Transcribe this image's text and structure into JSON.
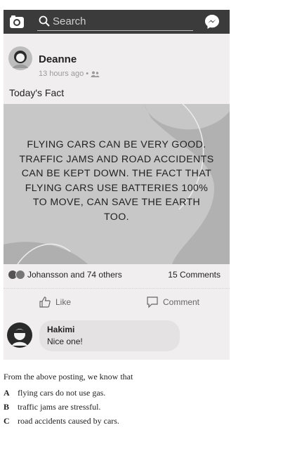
{
  "topbar": {
    "camera_icon": "camera-icon",
    "search_placeholder": "Search",
    "messenger_icon": "messenger-icon"
  },
  "post": {
    "author": "Deanne",
    "time": "13 hours ago",
    "audience_icon": "friends-icon",
    "caption": "Today's Fact",
    "fact_text": "FLYING CARS CAN BE VERY GOOD. TRAFFIC JAMS AND ROAD ACCIDENTS CAN BE KEPT DOWN. THE FACT THAT FLYING CARS USE BATTERIES 100% TO MOVE, CAN SAVE THE EARTH TOO.",
    "reactions_text": "Johansson and 74 others",
    "comments_text": "15 Comments",
    "like_label": "Like",
    "comment_label": "Comment"
  },
  "comment": {
    "name": "Hakimi",
    "text": "Nice one!"
  },
  "question": {
    "stem": "From the above posting, we know that",
    "options": [
      {
        "letter": "A",
        "text": "flying cars do not use gas."
      },
      {
        "letter": "B",
        "text": "traffic jams are stressful."
      },
      {
        "letter": "C",
        "text": "road accidents caused by cars."
      }
    ]
  },
  "colors": {
    "topbar": "#3b3b3b",
    "card_bg": "#f1eeef",
    "image_bg": "#c7c7c7"
  }
}
